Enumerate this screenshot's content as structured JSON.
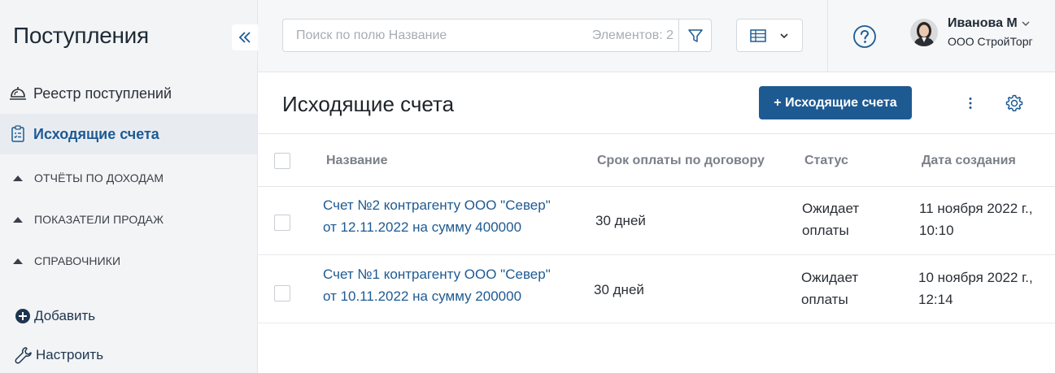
{
  "sidebar": {
    "title": "Поступления",
    "nav": [
      {
        "label": "Реестр поступлений"
      },
      {
        "label": "Исходящие счета"
      }
    ],
    "groups": [
      {
        "label": "ОТЧЁТЫ ПО ДОХОДАМ"
      },
      {
        "label": "ПОКАЗАТЕЛИ ПРОДАЖ"
      },
      {
        "label": "СПРАВОЧНИКИ"
      }
    ],
    "add_label": "Добавить",
    "settings_label": "Настроить"
  },
  "topbar": {
    "search_placeholder": "Поиск по полю Название",
    "count_text": "Элементов: 2",
    "user": {
      "name": "Иванова М",
      "company": "ООО СтройТорг"
    }
  },
  "main": {
    "title": "Исходящие счета",
    "add_button": "+ Исходящие счета",
    "columns": [
      "Название",
      "Срок оплаты по договору",
      "Статус",
      "Дата создания"
    ],
    "rows": [
      {
        "name_line1": "Счет №2 контрагенту ООО \"Север\"",
        "name_line2": "от 12.11.2022 на сумму 400000",
        "term": "30 дней",
        "status_line1": "Ожидает",
        "status_line2": "оплаты",
        "date_line1": "11 ноября 2022 г.,",
        "date_line2": "10:10"
      },
      {
        "name_line1": "Счет №1 контрагенту ООО \"Север\"",
        "name_line2": "от 10.11.2022 на сумму 200000",
        "term": "30 дней",
        "status_line1": "Ожидает",
        "status_line2": "оплаты",
        "date_line1": "10 ноября 2022 г.,",
        "date_line2": "12:14"
      }
    ]
  },
  "colors": {
    "accent": "#1e5a92",
    "sidebar_bg": "#f3f4f6",
    "topbar_bg": "#f6f7f8"
  }
}
